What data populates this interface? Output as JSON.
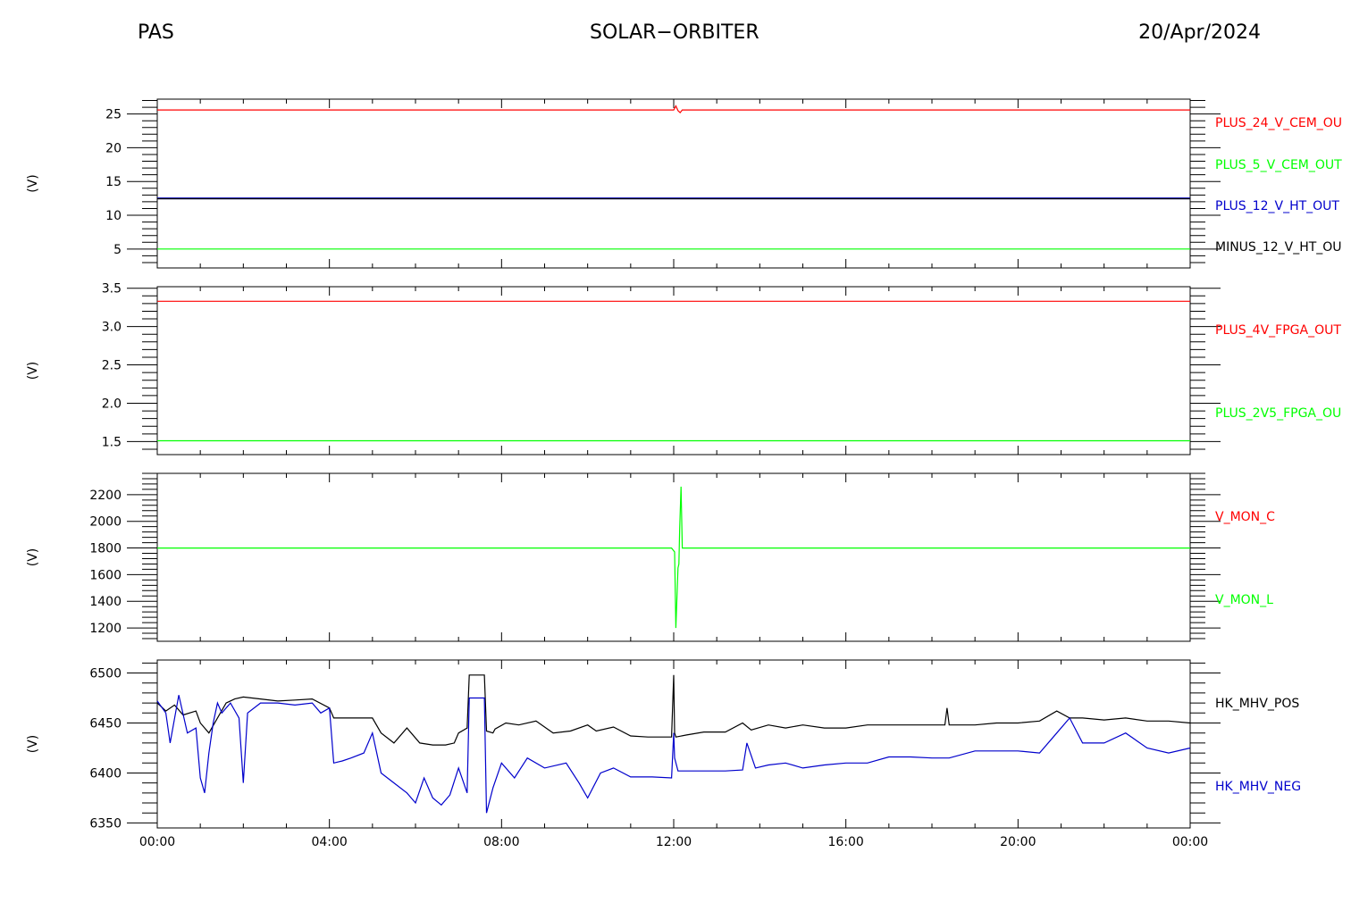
{
  "header": {
    "left": "PAS",
    "center": "SOLAR−ORBITER",
    "right": "20/Apr/2024"
  },
  "colors": {
    "red": "#ff0000",
    "green": "#00ff00",
    "blue": "#0000cc",
    "black": "#000000"
  },
  "chart_data": [
    {
      "type": "line",
      "ylabel": "(V)",
      "ylim": [
        2.2,
        27.2
      ],
      "yticks": [
        5,
        10,
        15,
        20,
        25
      ],
      "ytick_labels": [
        "5",
        "10",
        "15",
        "20",
        "25"
      ],
      "xlim": [
        "00:00",
        "24:00"
      ],
      "series": [
        {
          "name": "PLUS_24_V_CEM_OU",
          "color": "#ff0000",
          "x": [
            0,
            12.0,
            12.05,
            12.1,
            12.15,
            12.2,
            24
          ],
          "y": [
            25.6,
            25.6,
            26.2,
            25.5,
            25.2,
            25.6,
            25.6
          ]
        },
        {
          "name": "PLUS_5_V_CEM_OUT",
          "color": "#00ff00",
          "x": [
            0,
            24
          ],
          "y": [
            5.0,
            5.0
          ]
        },
        {
          "name": "PLUS_12_V_HT_OUT",
          "color": "#0000cc",
          "x": [
            0,
            24
          ],
          "y": [
            12.5,
            12.5
          ]
        },
        {
          "name": "MINUS_12_V_HT_OU",
          "color": "#000000",
          "x": [
            0,
            24
          ],
          "y": [
            12.45,
            12.45
          ]
        }
      ]
    },
    {
      "type": "line",
      "ylabel": "(V)",
      "ylim": [
        1.33,
        3.52
      ],
      "yticks": [
        1.5,
        2.0,
        2.5,
        3.0,
        3.5
      ],
      "ytick_labels": [
        "1.5",
        "2.0",
        "2.5",
        "3.0",
        "3.5"
      ],
      "xlim": [
        "00:00",
        "24:00"
      ],
      "series": [
        {
          "name": "PLUS_4V_FPGA_OUT",
          "color": "#ff0000",
          "x": [
            0,
            24
          ],
          "y": [
            3.33,
            3.33
          ]
        },
        {
          "name": "PLUS_2V5_FPGA_OU",
          "color": "#00ff00",
          "x": [
            0,
            24
          ],
          "y": [
            1.51,
            1.51
          ]
        }
      ]
    },
    {
      "type": "line",
      "ylabel": "(V)",
      "ylim": [
        1100,
        2360
      ],
      "yticks": [
        1200,
        1400,
        1600,
        1800,
        2000,
        2200
      ],
      "ytick_labels": [
        "1200",
        "1400",
        "1600",
        "1800",
        "2000",
        "2200"
      ],
      "xlim": [
        "00:00",
        "24:00"
      ],
      "series": [
        {
          "name": "V_MON_C",
          "color": "#ff0000",
          "x": [],
          "y": []
        },
        {
          "name": "V_MON_L",
          "color": "#00ff00",
          "x": [
            0,
            11.95,
            12.02,
            12.05,
            12.1,
            12.12,
            12.14,
            12.17,
            12.2,
            12.22,
            24
          ],
          "y": [
            1800,
            1800,
            1770,
            1200,
            1650,
            1680,
            1950,
            2260,
            1800,
            1800,
            1800
          ]
        }
      ]
    },
    {
      "type": "line",
      "ylabel": "(V)",
      "ylim": [
        6345,
        6513
      ],
      "yticks": [
        6350,
        6400,
        6450,
        6500
      ],
      "ytick_labels": [
        "6350",
        "6400",
        "6450",
        "6500"
      ],
      "xlim": [
        "00:00",
        "24:00"
      ],
      "xticks": [
        0,
        4,
        8,
        12,
        16,
        20,
        24
      ],
      "xtick_labels": [
        "00:00",
        "04:00",
        "08:00",
        "12:00",
        "16:00",
        "20:00",
        "00:00"
      ],
      "series": [
        {
          "name": "HK_MHV_POS",
          "color": "#000000",
          "x": [
            0,
            0.2,
            0.4,
            0.6,
            0.9,
            1.0,
            1.2,
            1.4,
            1.6,
            1.8,
            2.0,
            2.4,
            2.8,
            3.2,
            3.6,
            4.0,
            4.1,
            4.5,
            4.8,
            5.0,
            5.2,
            5.5,
            5.8,
            6.1,
            6.4,
            6.7,
            6.9,
            7.0,
            7.2,
            7.25,
            7.35,
            7.6,
            7.65,
            7.8,
            7.85,
            8.1,
            8.4,
            8.8,
            9.2,
            9.6,
            10.0,
            10.2,
            10.6,
            11.0,
            11.4,
            11.95,
            12.0,
            12.02,
            12.05,
            12.3,
            12.7,
            13.2,
            13.6,
            13.8,
            14.2,
            14.6,
            15.0,
            15.5,
            16.0,
            16.5,
            17.0,
            17.5,
            18.0,
            18.3,
            18.35,
            18.4,
            19.0,
            19.5,
            20.0,
            20.5,
            20.9,
            21.2,
            21.5,
            22.0,
            22.5,
            23.0,
            23.5,
            24
          ],
          "y": [
            6470,
            6462,
            6468,
            6458,
            6462,
            6450,
            6440,
            6455,
            6470,
            6474,
            6476,
            6474,
            6472,
            6473,
            6474,
            6465,
            6455,
            6455,
            6455,
            6455,
            6440,
            6430,
            6445,
            6430,
            6428,
            6428,
            6430,
            6440,
            6445,
            6498,
            6498,
            6498,
            6442,
            6440,
            6444,
            6450,
            6448,
            6452,
            6440,
            6442,
            6448,
            6442,
            6446,
            6437,
            6436,
            6436,
            6498,
            6440,
            6436,
            6438,
            6441,
            6441,
            6450,
            6443,
            6448,
            6445,
            6448,
            6445,
            6445,
            6448,
            6448,
            6448,
            6448,
            6448,
            6465,
            6448,
            6448,
            6450,
            6450,
            6452,
            6462,
            6455,
            6455,
            6453,
            6455,
            6452,
            6452,
            6450
          ]
        },
        {
          "name": "HK_MHV_NEG",
          "color": "#0000cc",
          "x": [
            0,
            0.2,
            0.3,
            0.5,
            0.7,
            0.9,
            1.0,
            1.1,
            1.2,
            1.3,
            1.4,
            1.5,
            1.7,
            1.9,
            2.0,
            2.1,
            2.4,
            2.8,
            3.2,
            3.6,
            3.8,
            4.0,
            4.1,
            4.3,
            4.5,
            4.8,
            5.0,
            5.2,
            5.5,
            5.8,
            6.0,
            6.2,
            6.4,
            6.6,
            6.8,
            7.0,
            7.2,
            7.25,
            7.35,
            7.6,
            7.65,
            7.8,
            8.0,
            8.3,
            8.6,
            9.0,
            9.5,
            9.8,
            10.0,
            10.3,
            10.6,
            11.0,
            11.5,
            11.95,
            12.0,
            12.02,
            12.1,
            12.3,
            12.7,
            13.2,
            13.6,
            13.7,
            13.9,
            14.2,
            14.6,
            15.0,
            15.5,
            16.0,
            16.5,
            17.0,
            17.5,
            18.0,
            18.3,
            18.35,
            18.4,
            19.0,
            19.5,
            20.0,
            20.5,
            20.9,
            21.2,
            21.5,
            22.0,
            22.5,
            23.0,
            23.5,
            24
          ],
          "y": [
            6472,
            6460,
            6430,
            6478,
            6440,
            6445,
            6395,
            6380,
            6420,
            6450,
            6470,
            6460,
            6470,
            6455,
            6390,
            6460,
            6470,
            6470,
            6468,
            6470,
            6460,
            6465,
            6410,
            6412,
            6415,
            6420,
            6440,
            6400,
            6390,
            6380,
            6370,
            6395,
            6375,
            6368,
            6378,
            6405,
            6380,
            6475,
            6475,
            6475,
            6360,
            6385,
            6410,
            6395,
            6415,
            6405,
            6410,
            6390,
            6375,
            6400,
            6405,
            6396,
            6396,
            6395,
            6440,
            6415,
            6402,
            6402,
            6402,
            6402,
            6403,
            6430,
            6405,
            6408,
            6410,
            6405,
            6408,
            6410,
            6410,
            6416,
            6416,
            6415,
            6415,
            6415,
            6415,
            6422,
            6422,
            6422,
            6420,
            6440,
            6455,
            6430,
            6430,
            6440,
            6425,
            6420,
            6425
          ]
        }
      ]
    }
  ]
}
